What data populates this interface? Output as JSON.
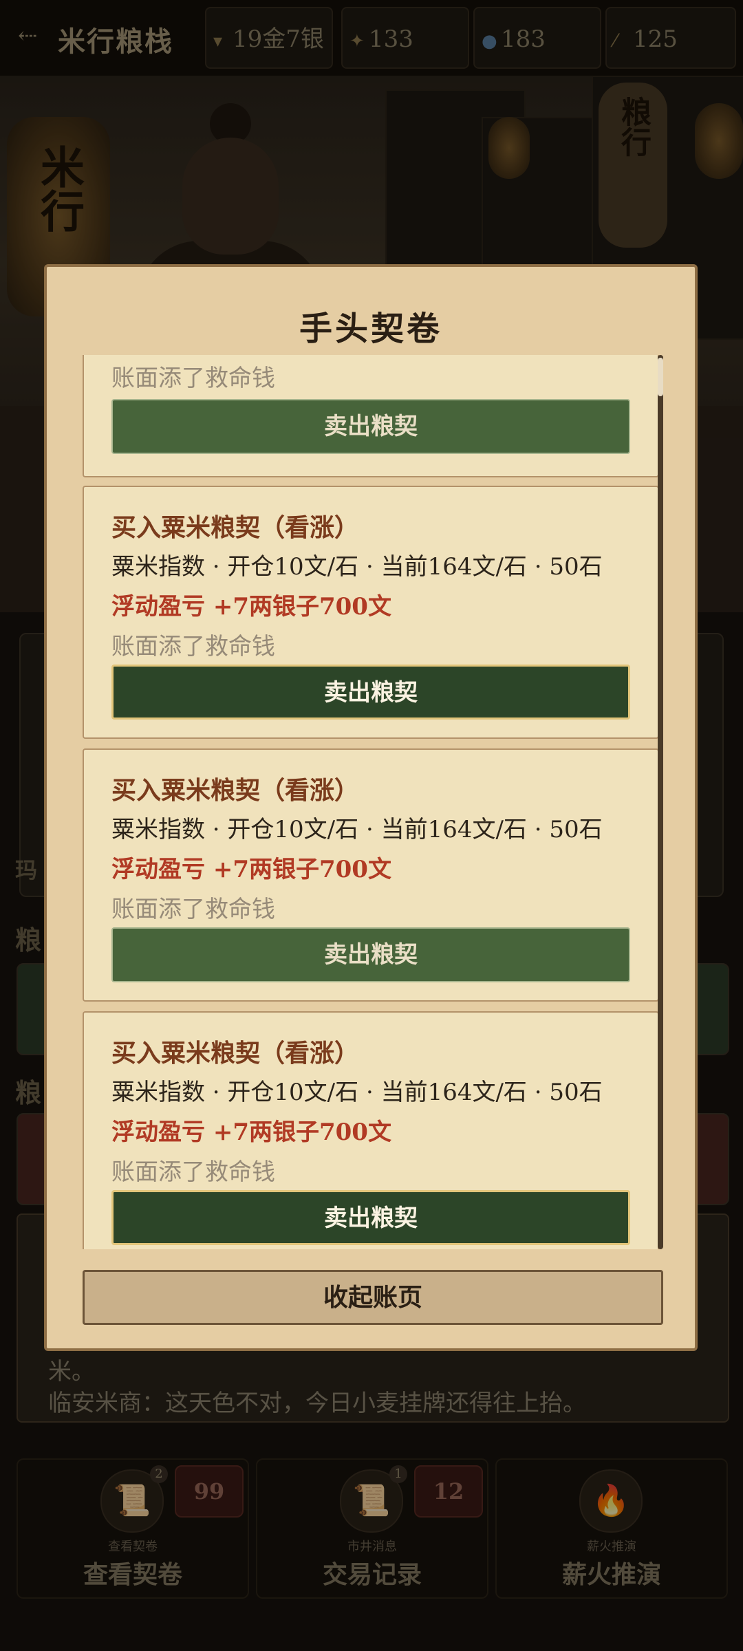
{
  "header": {
    "back_icon": "back-arrow-icon",
    "title": "米行粮栈",
    "resources": [
      {
        "icon": "gold-ingot-icon",
        "value": "19金7银"
      },
      {
        "icon": "grain-icon",
        "value": "133"
      },
      {
        "icon": "water-drop-icon",
        "value": "183"
      },
      {
        "icon": "feather-icon",
        "value": "125"
      }
    ]
  },
  "scene": {
    "lantern_left": "米行",
    "sign_right": "粮行"
  },
  "underlay": {
    "label_a": "粮",
    "label_b": "粮",
    "side_char": "玛",
    "dialog_line1": "米。",
    "dialog_line2": "临安米商：这天色不对，今日小麦挂牌还得往上抬。"
  },
  "bottom_nav": [
    {
      "icon": "scroll-icon",
      "badge": "2",
      "count": "99",
      "sub": "查看契卷",
      "label": "查看契卷"
    },
    {
      "icon": "scroll-icon",
      "badge": "1",
      "count": "12",
      "sub": "市井消息",
      "label": "交易记录"
    },
    {
      "icon": "fire-icon",
      "sub": "薪火推演",
      "label": "薪火推演"
    }
  ],
  "modal": {
    "title": "手头契卷",
    "partial_card": {
      "note": "账面添了救命钱",
      "sell_label": "卖出粮契"
    },
    "cards": [
      {
        "title": "买入粟米粮契（看涨）",
        "detail": "粟米指数 · 开仓10文/石 · 当前164文/石 · 50石",
        "pnl": "浮动盈亏 +7两银子700文",
        "note": "账面添了救命钱",
        "sell_label": "卖出粮契"
      },
      {
        "title": "买入粟米粮契（看涨）",
        "detail": "粟米指数 · 开仓10文/石 · 当前164文/石 · 50石",
        "pnl": "浮动盈亏 +7两银子700文",
        "note": "账面添了救命钱",
        "sell_label": "卖出粮契"
      },
      {
        "title": "买入粟米粮契（看涨）",
        "detail": "粟米指数 · 开仓10文/石 · 当前164文/石 · 50石",
        "pnl": "浮动盈亏 +7两银子700文",
        "note": "账面添了救命钱",
        "sell_label": "卖出粮契"
      }
    ],
    "close_label": "收起账页"
  }
}
